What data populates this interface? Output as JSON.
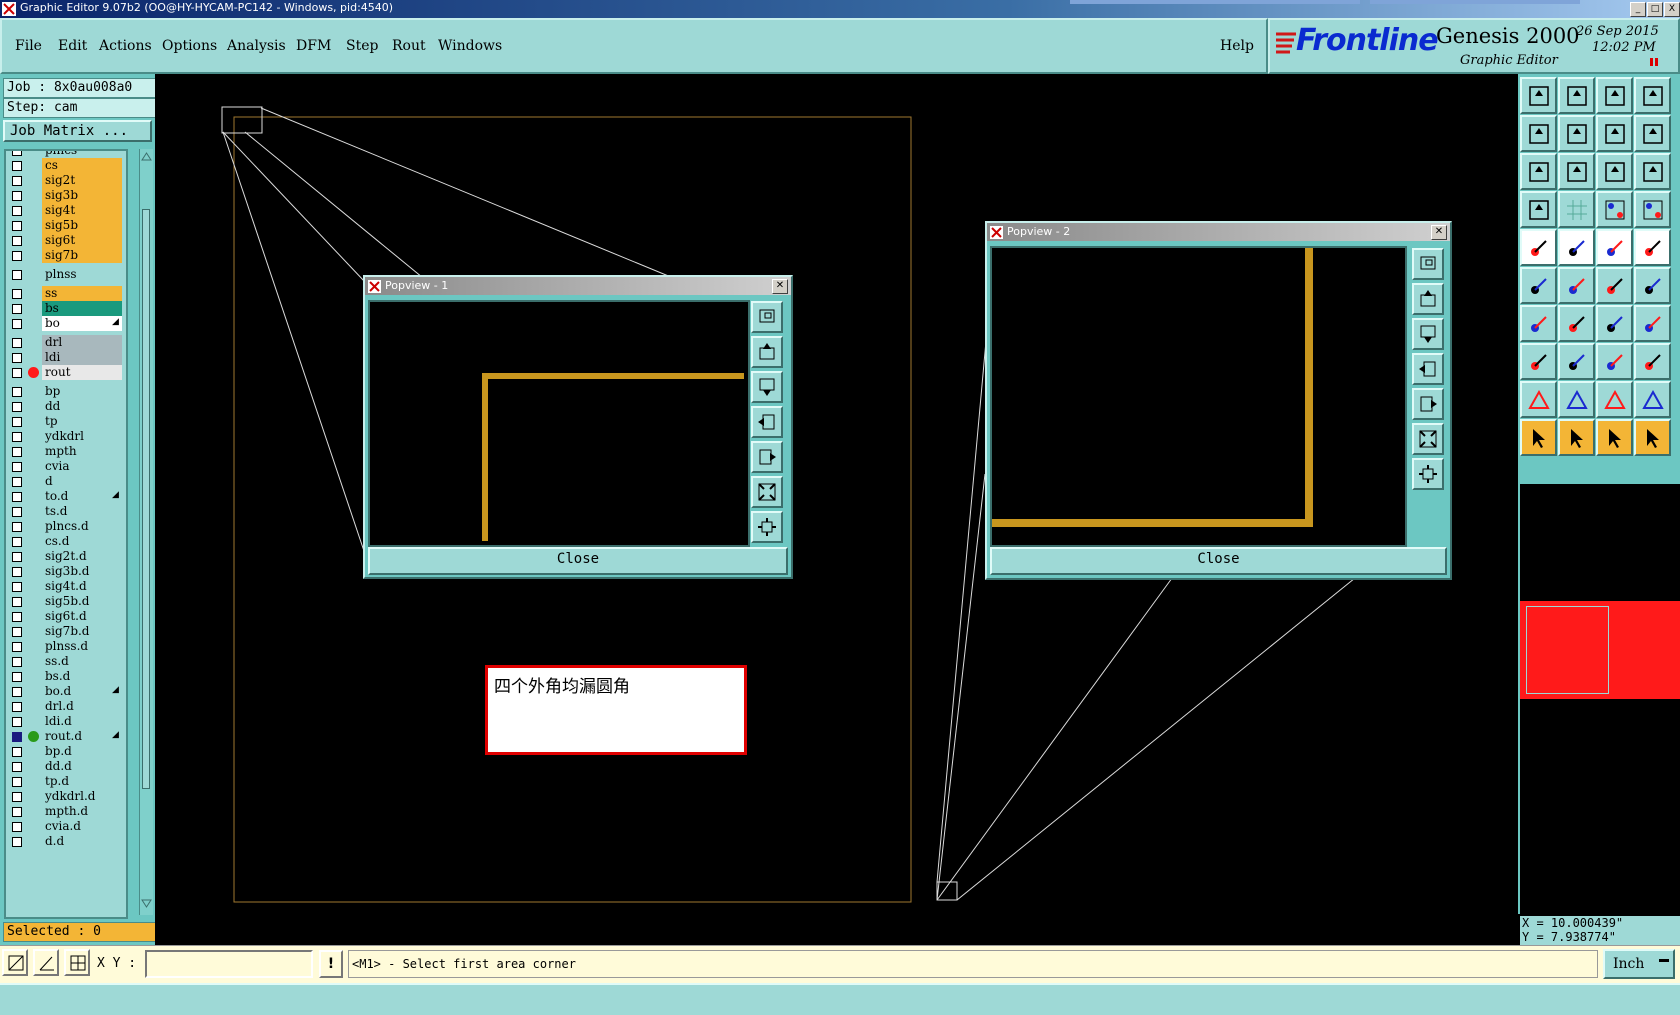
{
  "window": {
    "title": "Graphic Editor 9.07b2 (OO@HY-HYCAM-PC142 - Windows, pid:4540)",
    "minimize": "_",
    "maximize": "□",
    "close": "X"
  },
  "menu": {
    "items": [
      "File",
      "Edit",
      "Actions",
      "Options",
      "Analysis",
      "DFM",
      "Step",
      "Rout",
      "Windows"
    ],
    "help": "Help"
  },
  "brand": {
    "logo": "Frontline",
    "product": "Genesis 2000",
    "subtitle": "Graphic Editor",
    "date": "26 Sep 2015",
    "time": "12:02 PM"
  },
  "left": {
    "job": "Job : 8x0au008a0",
    "step": "Step: cam",
    "job_matrix_button": "Job Matrix ...",
    "selected": "Selected : 0",
    "layers": [
      {
        "name": "plncs",
        "color": "#9ed9d6",
        "partial": true
      },
      {
        "name": "cs",
        "color": "#f3b536"
      },
      {
        "name": "sig2t",
        "color": "#f3b536"
      },
      {
        "name": "sig3b",
        "color": "#f3b536"
      },
      {
        "name": "sig4t",
        "color": "#f3b536"
      },
      {
        "name": "sig5b",
        "color": "#f3b536"
      },
      {
        "name": "sig6t",
        "color": "#f3b536"
      },
      {
        "name": "sig7b",
        "color": "#f3b536"
      },
      {
        "name": "plnss",
        "color": "#9ed9d6",
        "gap": true
      },
      {
        "name": "ss",
        "color": "#f3b536",
        "gap": true
      },
      {
        "name": "bs",
        "color": "#1a9a7e"
      },
      {
        "name": "bo",
        "color": "#ffffff",
        "mark": true
      },
      {
        "name": "drl",
        "color": "#a8b8bd",
        "gap": true
      },
      {
        "name": "ldi",
        "color": "#a8b8bd"
      },
      {
        "name": "rout",
        "color": "#e8e8e8",
        "dot": "#ff1a1a"
      },
      {
        "name": "bp",
        "color": "#9ed9d6",
        "gap": true
      },
      {
        "name": "dd",
        "color": "#9ed9d6"
      },
      {
        "name": "tp",
        "color": "#9ed9d6"
      },
      {
        "name": "ydkdrl",
        "color": "#9ed9d6"
      },
      {
        "name": "mpth",
        "color": "#9ed9d6"
      },
      {
        "name": "cvia",
        "color": "#9ed9d6"
      },
      {
        "name": "d",
        "color": "#9ed9d6"
      },
      {
        "name": "to.d",
        "color": "#9ed9d6",
        "mark": true
      },
      {
        "name": "ts.d",
        "color": "#9ed9d6"
      },
      {
        "name": "plncs.d",
        "color": "#9ed9d6"
      },
      {
        "name": "cs.d",
        "color": "#9ed9d6"
      },
      {
        "name": "sig2t.d",
        "color": "#9ed9d6"
      },
      {
        "name": "sig3b.d",
        "color": "#9ed9d6"
      },
      {
        "name": "sig4t.d",
        "color": "#9ed9d6"
      },
      {
        "name": "sig5b.d",
        "color": "#9ed9d6"
      },
      {
        "name": "sig6t.d",
        "color": "#9ed9d6"
      },
      {
        "name": "sig7b.d",
        "color": "#9ed9d6"
      },
      {
        "name": "plnss.d",
        "color": "#9ed9d6"
      },
      {
        "name": "ss.d",
        "color": "#9ed9d6"
      },
      {
        "name": "bs.d",
        "color": "#9ed9d6"
      },
      {
        "name": "bo.d",
        "color": "#9ed9d6",
        "mark": true
      },
      {
        "name": "drl.d",
        "color": "#9ed9d6"
      },
      {
        "name": "ldi.d",
        "color": "#9ed9d6"
      },
      {
        "name": "rout.d",
        "color": "#9ed9d6",
        "dot": "#2a9a1a",
        "checked": true,
        "mark": true
      },
      {
        "name": "bp.d",
        "color": "#9ed9d6"
      },
      {
        "name": "dd.d",
        "color": "#9ed9d6"
      },
      {
        "name": "tp.d",
        "color": "#9ed9d6"
      },
      {
        "name": "ydkdrl.d",
        "color": "#9ed9d6"
      },
      {
        "name": "mpth.d",
        "color": "#9ed9d6"
      },
      {
        "name": "cvia.d",
        "color": "#9ed9d6"
      },
      {
        "name": "d.d",
        "color": "#9ed9d6"
      }
    ]
  },
  "popup1": {
    "title": "Popview - 1",
    "close_label": "Close"
  },
  "popup2": {
    "title": "Popview - 2",
    "close_label": "Close"
  },
  "note": {
    "text": "四个外角均漏圆角"
  },
  "coords": {
    "x": "X = 10.000439\"",
    "y": "Y = 7.938774\""
  },
  "bottom": {
    "xy_label": "X Y :",
    "xy_value": "",
    "excl": "!",
    "prompt": "<M1> - Select first area corner",
    "units": "Inch"
  },
  "colors": {
    "panel": "#9ed9d6",
    "trace": "#c8961e",
    "board_outline": "#a07830",
    "alert": "#e00000"
  }
}
